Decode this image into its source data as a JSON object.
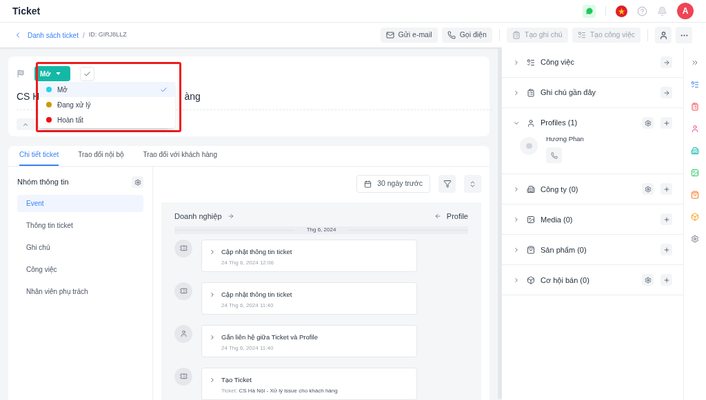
{
  "header": {
    "title": "Ticket",
    "avatar_initial": "A"
  },
  "breadcrumb": {
    "back_link": "Danh sách ticket",
    "separator": "/",
    "id": "ID: GIRJ8LLZ"
  },
  "actions": [
    {
      "kind": "email",
      "label": "Gửi e-mail",
      "disabled": false
    },
    {
      "kind": "call",
      "label": "Gọi điện",
      "disabled": false
    },
    {
      "kind": "note",
      "label": "Tạo ghi chú",
      "disabled": true
    },
    {
      "kind": "task",
      "label": "Tạo công việc",
      "disabled": true
    }
  ],
  "status": {
    "current": "Mở",
    "options": [
      {
        "label": "Mở",
        "color": "#22d3ee",
        "selected": true
      },
      {
        "label": "Đang xử lý",
        "color": "#ca9a04",
        "selected": false
      },
      {
        "label": "Hoàn tất",
        "color": "#ef1010",
        "selected": false
      }
    ]
  },
  "title_visible": {
    "start": "CS H",
    "end": "àng"
  },
  "tabs": [
    {
      "label": "Chi tiết ticket",
      "selected": true
    },
    {
      "label": "Trao đổi nội bộ",
      "selected": false
    },
    {
      "label": "Trao đổi với khách hàng",
      "selected": false
    }
  ],
  "info_group": {
    "title": "Nhóm thông tin",
    "items": [
      {
        "label": "Event",
        "selected": true
      },
      {
        "label": "Thông tin ticket",
        "selected": false
      },
      {
        "label": "Ghi chú",
        "selected": false
      },
      {
        "label": "Công việc",
        "selected": false
      },
      {
        "label": "Nhân viên phụ trách",
        "selected": false
      }
    ]
  },
  "timeline": {
    "date_filter": "30 ngày trước",
    "left_link": "Doanh nghiệp",
    "right_link": "Profile",
    "date_divider": "Thg 6, 2024",
    "events": [
      {
        "kind": "ticket",
        "title": "Cập nhật thông tin ticket",
        "time": "24 Thg 6, 2024 12:06"
      },
      {
        "kind": "ticket",
        "title": "Cập nhật thông tin ticket",
        "time": "24 Thg 6, 2024 11:40"
      },
      {
        "kind": "profile",
        "title": "Gắn liên hệ giữa Ticket và Profile",
        "time": "24 Thg 6, 2024 11:40"
      },
      {
        "kind": "ticket",
        "title": "Tạo Ticket",
        "detail_label": "Ticket:",
        "detail": "CS Hà Nội - Xử lý issue cho khách hàng"
      }
    ]
  },
  "side_sections": [
    {
      "kind": "task",
      "label": "Công việc",
      "expanded": false,
      "settings": false,
      "open": true,
      "add": false
    },
    {
      "kind": "note",
      "label": "Ghi chú gần đây",
      "expanded": false,
      "settings": false,
      "open": true,
      "add": false
    },
    {
      "kind": "profile",
      "label": "Profiles (1)",
      "expanded": true,
      "settings": true,
      "open": false,
      "add": true,
      "children": [
        {
          "name": "Hương Phan"
        }
      ]
    },
    {
      "kind": "company",
      "label": "Công ty (0)",
      "expanded": false,
      "settings": true,
      "open": false,
      "add": true
    },
    {
      "kind": "media",
      "label": "Media (0)",
      "expanded": false,
      "settings": false,
      "open": false,
      "add": true
    },
    {
      "kind": "product",
      "label": "Sản phẩm (0)",
      "expanded": false,
      "settings": false,
      "open": false,
      "add": true
    },
    {
      "kind": "deal",
      "label": "Cơ hội bán (0)",
      "expanded": false,
      "settings": true,
      "open": false,
      "add": true
    }
  ]
}
